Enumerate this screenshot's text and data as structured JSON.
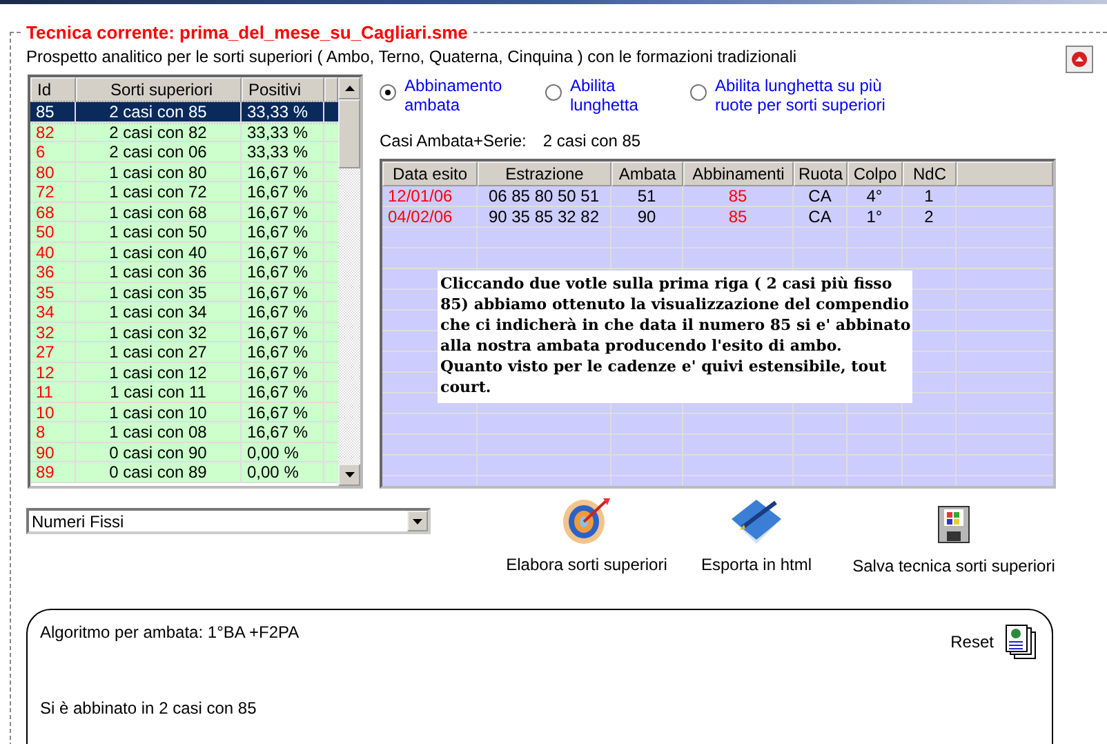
{
  "frame": {
    "legend": "Tecnica corrente: prima_del_mese_su_Cagliari.sme",
    "description": "Prospetto analitico per le sorti superiori ( Ambo, Terno, Quaterna, Cinquina ) con le formazioni tradizionali"
  },
  "sorti_table": {
    "columns": [
      "Id",
      "Sorti superiori",
      "Positivi"
    ],
    "rows": [
      {
        "id": "85",
        "sorte": "2 casi con 85",
        "positivi": "33,33 %",
        "selected": true
      },
      {
        "id": "82",
        "sorte": "2 casi con 82",
        "positivi": "33,33 %",
        "selected": false
      },
      {
        "id": "6",
        "sorte": "2 casi con 06",
        "positivi": "33,33 %",
        "selected": false
      },
      {
        "id": "80",
        "sorte": "1 casi con 80",
        "positivi": "16,67 %",
        "selected": false
      },
      {
        "id": "72",
        "sorte": "1 casi con 72",
        "positivi": "16,67 %",
        "selected": false
      },
      {
        "id": "68",
        "sorte": "1 casi con 68",
        "positivi": "16,67 %",
        "selected": false
      },
      {
        "id": "50",
        "sorte": "1 casi con 50",
        "positivi": "16,67 %",
        "selected": false
      },
      {
        "id": "40",
        "sorte": "1 casi con 40",
        "positivi": "16,67 %",
        "selected": false
      },
      {
        "id": "36",
        "sorte": "1 casi con 36",
        "positivi": "16,67 %",
        "selected": false
      },
      {
        "id": "35",
        "sorte": "1 casi con 35",
        "positivi": "16,67 %",
        "selected": false
      },
      {
        "id": "34",
        "sorte": "1 casi con 34",
        "positivi": "16,67 %",
        "selected": false
      },
      {
        "id": "32",
        "sorte": "1 casi con 32",
        "positivi": "16,67 %",
        "selected": false
      },
      {
        "id": "27",
        "sorte": "1 casi con 27",
        "positivi": "16,67 %",
        "selected": false
      },
      {
        "id": "12",
        "sorte": "1 casi con 12",
        "positivi": "16,67 %",
        "selected": false
      },
      {
        "id": "11",
        "sorte": "1 casi con 11",
        "positivi": "16,67 %",
        "selected": false
      },
      {
        "id": "10",
        "sorte": "1 casi con 10",
        "positivi": "16,67 %",
        "selected": false
      },
      {
        "id": "8",
        "sorte": "1 casi con 08",
        "positivi": "16,67 %",
        "selected": false
      },
      {
        "id": "90",
        "sorte": "0 casi con 90",
        "positivi": "0,00 %",
        "selected": false
      },
      {
        "id": "89",
        "sorte": "0 casi con 89",
        "positivi": "0,00 %",
        "selected": false
      }
    ]
  },
  "options": [
    {
      "label": "Abbinamento ambata",
      "selected": true
    },
    {
      "label": "Abilita lunghetta",
      "selected": false
    },
    {
      "label": "Abilita lunghetta su più ruote per sorti superiori",
      "selected": false
    }
  ],
  "casi": {
    "label": "Casi Ambata+Serie:",
    "value": "2 casi con 85"
  },
  "esiti_table": {
    "columns": [
      "Data esito",
      "Estrazione",
      "Ambata",
      "Abbinamenti",
      "Ruota",
      "Colpo",
      "NdC"
    ],
    "rows": [
      [
        "12/01/06",
        "06 85 80 50 51",
        "51",
        "85",
        "CA",
        "4°",
        "1"
      ],
      [
        "04/02/06",
        "90 35 85 32 82",
        "90",
        "85",
        "CA",
        "1°",
        "2"
      ]
    ]
  },
  "note": [
    "Cliccando due votle sulla prima riga ( 2 casi più fisso 85) abbiamo ottenuto la visualizzazione del compendio che ci indicherà in che data il numero 85 si e' abbinato alla nostra ambata producendo l'esito di ambo.",
    "Quanto visto per le cadenze e' quivi estensibile, tout court."
  ],
  "dropdown": {
    "value": "Numeri Fissi"
  },
  "actions": [
    {
      "kind": "target",
      "label": "Elabora sorti superiori"
    },
    {
      "kind": "book",
      "label": "Esporta in html"
    },
    {
      "kind": "floppy",
      "label": "Salva tecnica sorti superiori"
    }
  ],
  "result_panel": {
    "algorithm": "Algoritmo per ambata: 1°BA +F2PA",
    "reset": "Reset",
    "result": "Si è abbinato in 2 casi con 85"
  }
}
